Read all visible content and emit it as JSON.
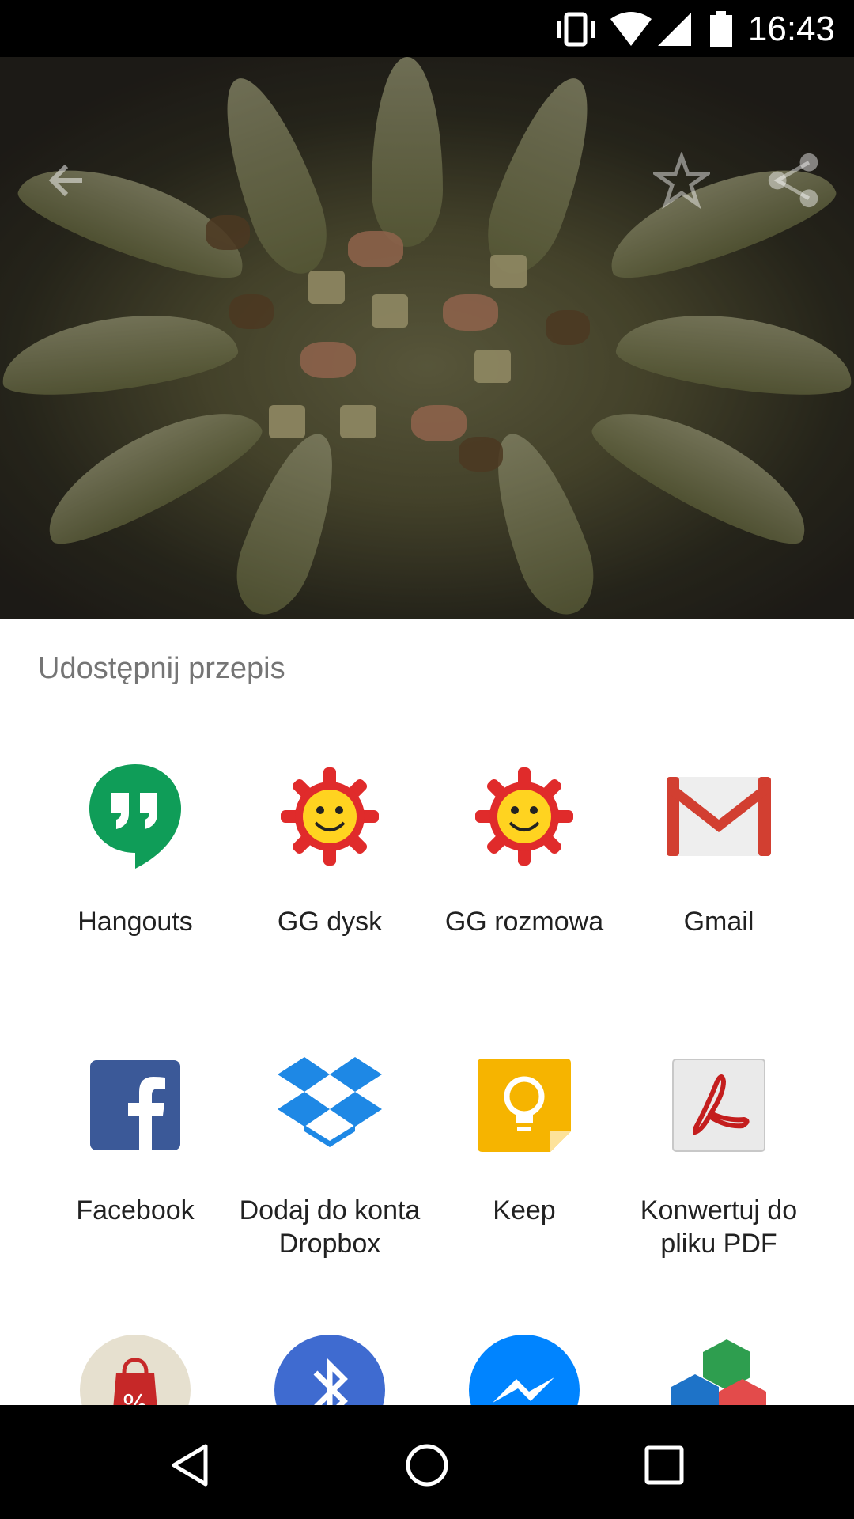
{
  "status_bar": {
    "time": "16:43",
    "icons": [
      "vibrate-icon",
      "wifi-icon",
      "signal-icon",
      "battery-icon"
    ]
  },
  "hero": {
    "back_icon": "back-arrow-icon",
    "favorite_icon": "star-outline-icon",
    "share_icon": "share-icon"
  },
  "share_sheet": {
    "title": "Udostępnij przepis",
    "apps": [
      {
        "label": "Hangouts",
        "icon": "hangouts-icon"
      },
      {
        "label": "GG dysk",
        "icon": "gg-sun-icon"
      },
      {
        "label": "GG rozmowa",
        "icon": "gg-sun-icon"
      },
      {
        "label": "Gmail",
        "icon": "gmail-icon"
      },
      {
        "label": "Facebook",
        "icon": "facebook-icon"
      },
      {
        "label": "Dodaj do konta\nDropbox",
        "icon": "dropbox-icon"
      },
      {
        "label": "Keep",
        "icon": "keep-icon"
      },
      {
        "label": "Konwertuj do\npliku PDF",
        "icon": "pdf-icon"
      },
      {
        "label": "",
        "icon": "discount-bag-icon"
      },
      {
        "label": "",
        "icon": "bluetooth-icon"
      },
      {
        "label": "",
        "icon": "messenger-icon"
      },
      {
        "label": "",
        "icon": "cubes-icon"
      }
    ]
  },
  "nav_bar": {
    "back": "nav-back-icon",
    "home": "nav-home-icon",
    "recents": "nav-recents-icon"
  },
  "colors": {
    "hangouts": "#0F9D58",
    "gg_sun": "#E02B2B",
    "gmail_red": "#D23F31",
    "facebook": "#3B5998",
    "dropbox": "#1E88E5",
    "keep": "#F6B400",
    "bluetooth": "#3F6BD0",
    "messenger": "#0084FF"
  }
}
